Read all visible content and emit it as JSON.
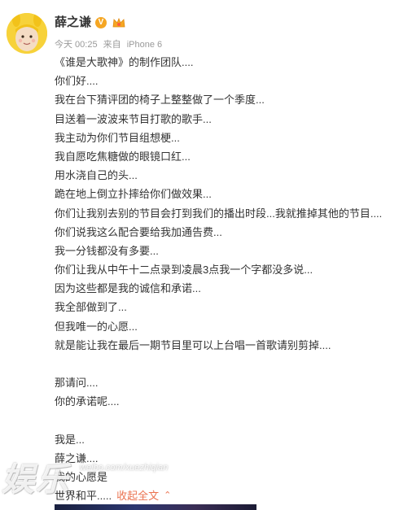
{
  "author": {
    "name": "薛之谦",
    "verified_icon": "verified-badge-icon",
    "vip_icon": "vip-member-icon"
  },
  "meta": {
    "time": "今天 00:25",
    "source_prefix": "来自",
    "source": "iPhone 6"
  },
  "post_lines": [
    "《谁是大歌神》的制作团队....",
    "你们好....",
    "我在台下猜评团的椅子上整整做了一个季度...",
    "目送着一波波来节目打歌的歌手...",
    "我主动为你们节目组想梗...",
    "我自愿吃焦糖做的眼镜口红...",
    "用水浇自己的头...",
    "跪在地上倒立扑摔给你们做效果...",
    "你们让我别去别的节目会打到我们的播出时段...我就推掉其他的节目....",
    "你们说我这么配合要给我加通告费...",
    "我一分钱都没有多要...",
    "你们让我从中午十二点录到凌晨3点我一个字都没多说...",
    "因为这些都是我的诚信和承诺...",
    "我全部做到了...",
    "但我唯一的心愿...",
    "就是能让我在最后一期节目里可以上台唱一首歌请别剪掉....",
    "",
    "那请问....",
    "你的承诺呢....",
    "",
    "我是...",
    "薛之谦....",
    "我的心愿是"
  ],
  "last_line": "世界和平.....",
  "collapse_label": "收起全文",
  "collapse_icon": "chevron-up-icon",
  "watermark": {
    "main": "娱乐",
    "sub": "weibo.com/xuezhiqian"
  },
  "colors": {
    "link": "#eb7350",
    "meta": "#999999",
    "text": "#333333",
    "avatar_bg": "#f7d23a",
    "verified": "#f5a623"
  }
}
